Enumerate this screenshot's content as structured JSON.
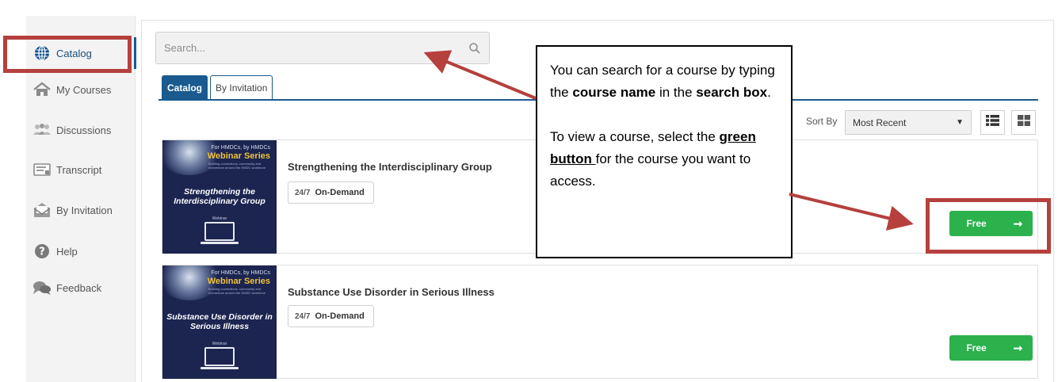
{
  "sidebar": {
    "items": [
      {
        "label": "Catalog",
        "icon": "globe-icon",
        "active": true
      },
      {
        "label": "My Courses",
        "icon": "home-icon"
      },
      {
        "label": "Discussions",
        "icon": "discussions-icon"
      },
      {
        "label": "Transcript",
        "icon": "transcript-icon"
      },
      {
        "label": "By Invitation",
        "icon": "envelope-icon"
      },
      {
        "label": "Help",
        "icon": "help-icon"
      },
      {
        "label": "Feedback",
        "icon": "feedback-icon"
      }
    ]
  },
  "search": {
    "placeholder": "Search...",
    "icon": "search-icon"
  },
  "tabs": [
    {
      "label": "Catalog",
      "active": true
    },
    {
      "label": "By Invitation",
      "active": false
    }
  ],
  "sort": {
    "label": "Sort By",
    "selected": "Most Recent",
    "views": [
      "list-view-icon",
      "grid-view-icon"
    ]
  },
  "courses": [
    {
      "title": "Strengthening the Interdisciplinary Group",
      "badge": "On-Demand",
      "badge_icon": "24/7",
      "button": "Free",
      "thumb": {
        "series_top": "For HMDCs, by HMDCs",
        "series": "Webinar Series",
        "tagline": "Building connections, community and momentum around the HMDC workforce",
        "title": "Strengthening the Interdisciplinary Group",
        "tag": "Webinar"
      }
    },
    {
      "title": "Substance Use Disorder in Serious Illness",
      "badge": "On-Demand",
      "badge_icon": "24/7",
      "button": "Free",
      "thumb": {
        "series_top": "For HMDCs, by HMDCs",
        "series": "Webinar Series",
        "tagline": "Building connections, community and momentum around the HMDC workforce",
        "title": "Substance Use Disorder in Serious Illness",
        "tag": "Webinar"
      }
    }
  ],
  "callout": {
    "p1_a": "You can search for a course by typing the ",
    "p1_b": "course name",
    "p1_c": " in the ",
    "p1_d": "search box",
    "p1_e": ".",
    "p2_a": "To view a course, select the ",
    "p2_b": "green button ",
    "p2_c": "for the course you want to access."
  },
  "colors": {
    "primary": "#1a5a8e",
    "button": "#2bb24c",
    "annotation": "#b5403d",
    "thumb": "#1b2550",
    "series": "#f1c23b"
  }
}
